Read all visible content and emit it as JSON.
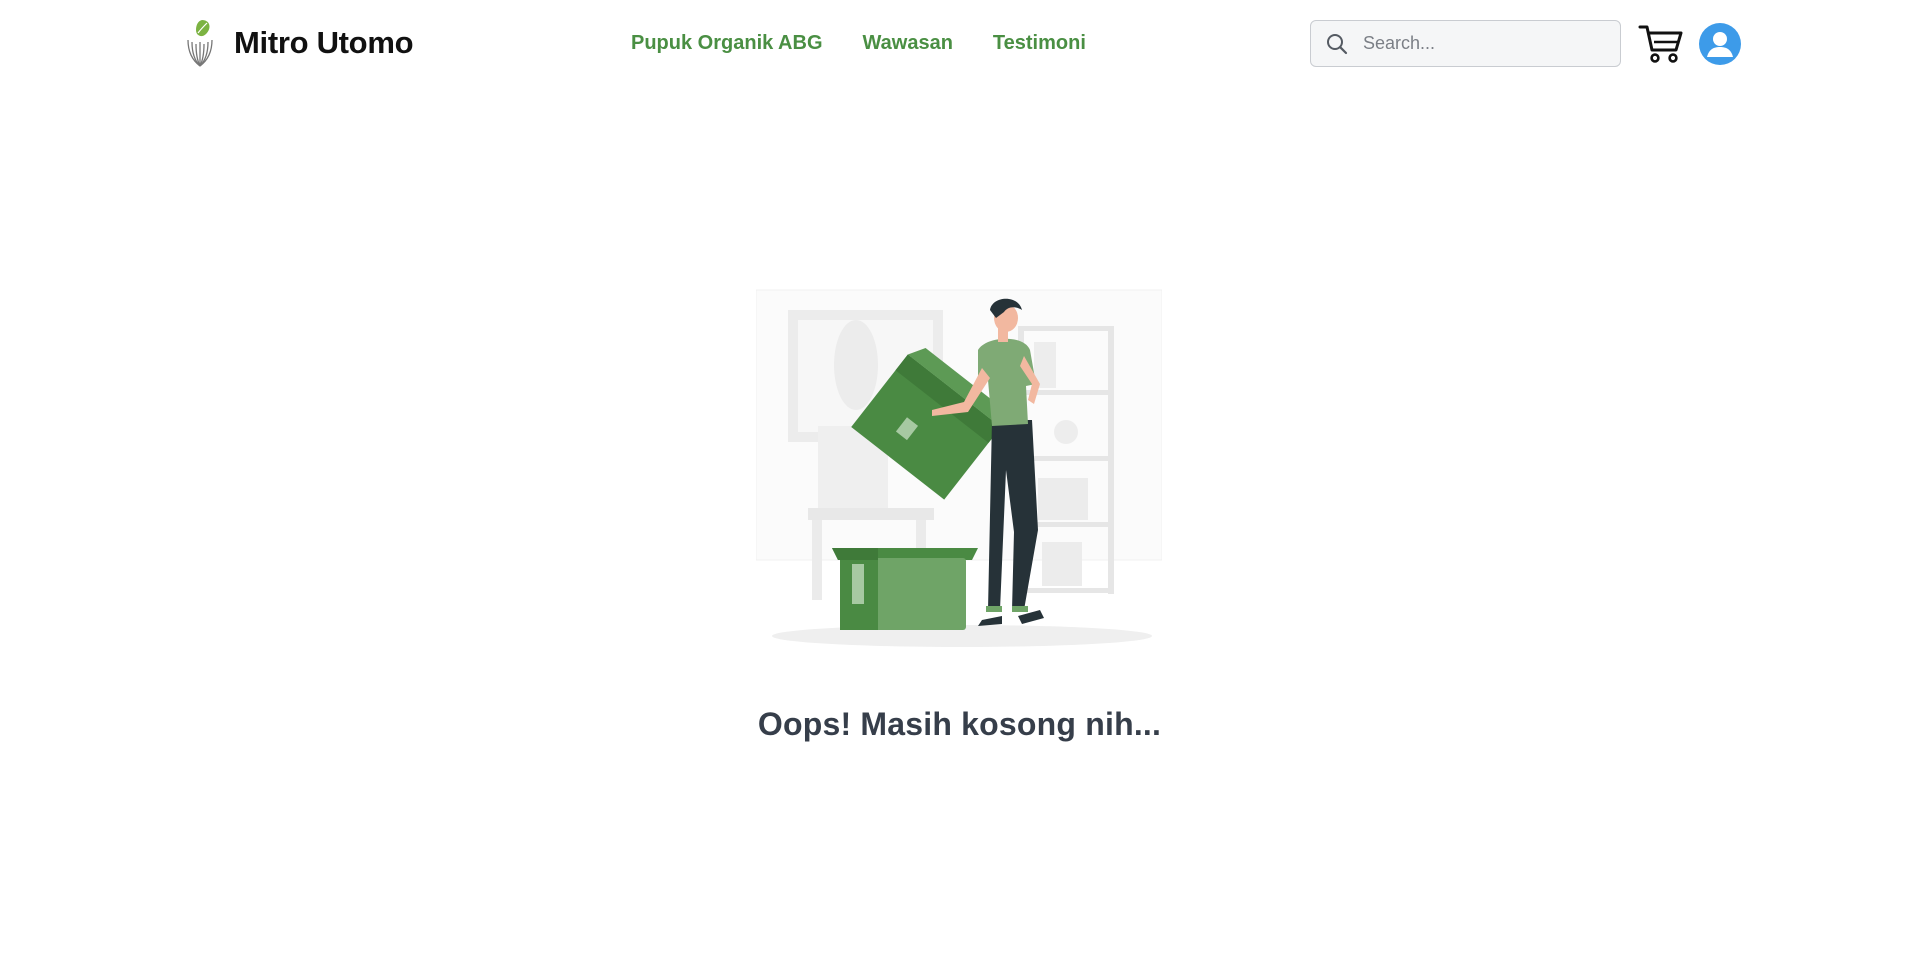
{
  "brand": {
    "name": "Mitro Utomo",
    "logo_icon": "leaf-wheat-logo-icon"
  },
  "nav": {
    "items": [
      {
        "label": "Pupuk Organik ABG"
      },
      {
        "label": "Wawasan"
      },
      {
        "label": "Testimoni"
      }
    ]
  },
  "search": {
    "placeholder": "Search...",
    "value": "",
    "icon": "search-icon"
  },
  "cart": {
    "icon": "cart-icon"
  },
  "account": {
    "icon": "user-avatar-icon"
  },
  "empty_state": {
    "message": "Oops! Masih kosong nih...",
    "illustration": "man-unpacking-box-illustration"
  },
  "colors": {
    "nav_green": "#4a8f43",
    "avatar_blue": "#3d9be9",
    "box_green": "#4a8a43",
    "box_green_light": "#6fa467",
    "message_text": "#363e4a",
    "brand_text": "#111111"
  }
}
